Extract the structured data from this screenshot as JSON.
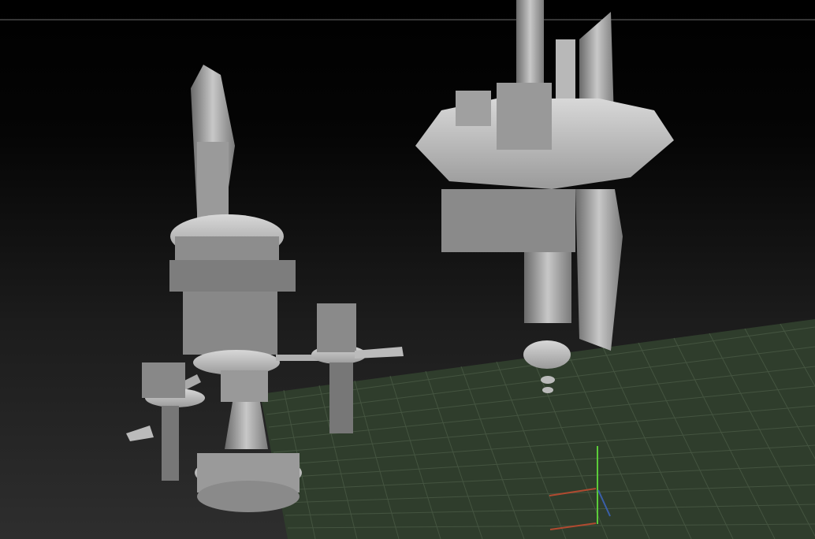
{
  "viewport": {
    "background_top": "#000000",
    "background_bottom": "#2e2e2e",
    "floor_color": "#2f3d2c",
    "grid_color": "#4d5e48",
    "model_color": "#a8a8a8",
    "horizon_line_color": "#6a6a6a"
  },
  "gizmo": {
    "x_axis_color": "#b04a30",
    "y_axis_color": "#5ccc3a",
    "z_axis_color": "#3a5fa8"
  }
}
